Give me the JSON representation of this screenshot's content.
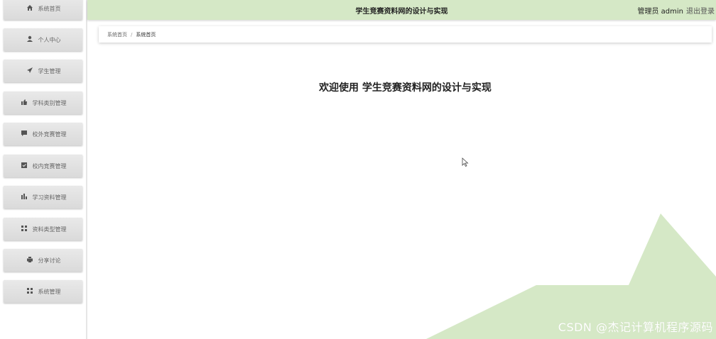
{
  "sidebar": {
    "items": [
      {
        "label": "系统首页",
        "icon": "home-icon"
      },
      {
        "label": "个人中心",
        "icon": "user-icon"
      },
      {
        "label": "学生管理",
        "icon": "paper-plane-icon"
      },
      {
        "label": "学科类别管理",
        "icon": "thumbs-up-icon"
      },
      {
        "label": "校外竞赛管理",
        "icon": "comment-icon"
      },
      {
        "label": "校内竞赛管理",
        "icon": "checkbox-icon"
      },
      {
        "label": "学习资料管理",
        "icon": "bar-chart-icon"
      },
      {
        "label": "资料类型管理",
        "icon": "grid-icon"
      },
      {
        "label": "分享讨论",
        "icon": "print-icon"
      },
      {
        "label": "系统管理",
        "icon": "grid-icon"
      }
    ]
  },
  "header": {
    "title": "学生竞赛资料网的设计与实现",
    "user": "管理员 admin",
    "logout": "退出登录"
  },
  "breadcrumb": {
    "root": "系统首页",
    "separator": "/",
    "current": "系统首页"
  },
  "main": {
    "welcome": "欢迎使用 学生竞赛资料网的设计与实现"
  },
  "watermark": "CSDN @杰记计算机程序源码",
  "colors": {
    "accent": "#d5e8c6",
    "menu_bg": "#dedede"
  }
}
